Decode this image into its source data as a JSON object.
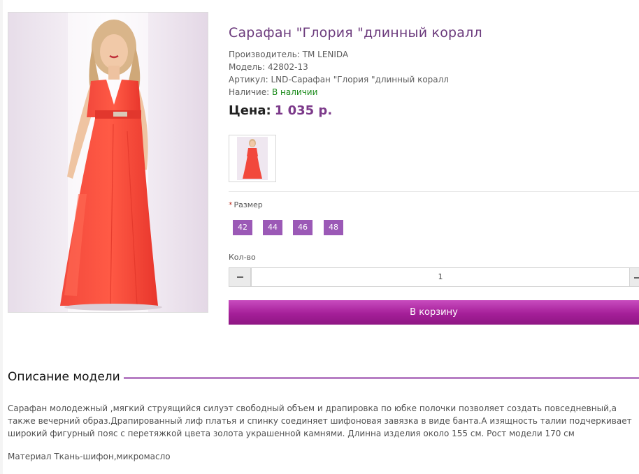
{
  "product": {
    "title": "Сарафан \"Глория \"длинный коралл",
    "manufacturer": "Производитель: ТМ LENIDA",
    "model": "Модель: 42802-13",
    "sku": "Артикул: LND-Сарафан \"Глория \"длинный коралл",
    "availability_label": "Наличие:",
    "availability_value": "В наличии",
    "price_label": "Цена:",
    "price_value": "1 035 р."
  },
  "options": {
    "size_label": "Размер",
    "required_mark": "*",
    "sizes": [
      "42",
      "44",
      "46",
      "48"
    ]
  },
  "quantity": {
    "label": "Кол-во",
    "value": "1"
  },
  "cart": {
    "button_label": "В корзину"
  },
  "description": {
    "heading": "Описание модели",
    "text": "Сарафан молодежный ,мягкий струящийся силуэт свободный объем и драпировка по юбке полочки позволяет создать повседневный,а также вечерний образ.Драпированный лиф платья и спинку соединяет шифоновая завязка в виде банта.А изящность талии подчеркивает широкий фигурный пояс с перетяжкой цвета золота украшенной камнями. Длинна изделия около 155 см. Рост модели 170 см",
    "material": "Материал Ткань-шифон,микромасло"
  },
  "colors": {
    "accent": "#6b3a7c",
    "size_button": "#9b59b6",
    "cart_button": "#a51f99",
    "in_stock": "#1a8a1a",
    "dress": "#f0392f"
  }
}
